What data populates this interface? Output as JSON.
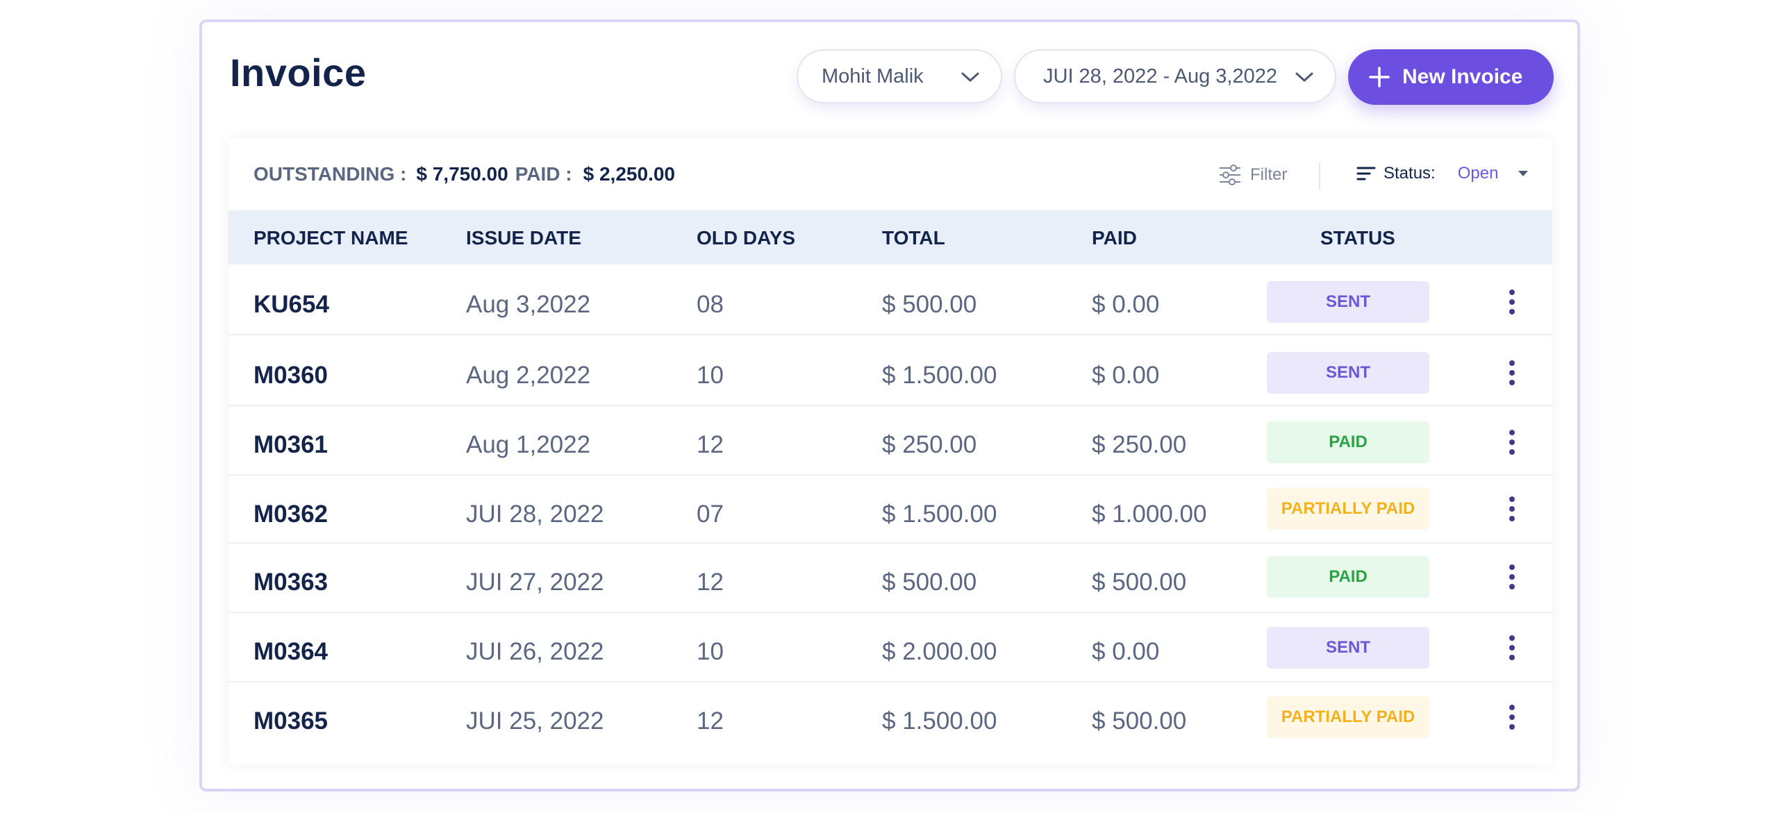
{
  "header": {
    "title": "Invoice",
    "user_select": "Mohit Malik",
    "date_range": "JUI 28, 2022 - Aug 3,2022",
    "new_invoice_label": "New Invoice"
  },
  "summary": {
    "outstanding_label": "OUTSTANDING :",
    "outstanding_value": "$ 7,750.00",
    "paid_label": "PAID :",
    "paid_value": "$ 2,250.00"
  },
  "filters": {
    "filter_label": "Filter",
    "status_label": "Status:",
    "status_value": "Open"
  },
  "table": {
    "columns": [
      "PROJECT NAME",
      "ISSUE DATE",
      "OLD DAYS",
      "TOTAL",
      "PAID",
      "STATUS"
    ],
    "rows": [
      {
        "project": "KU654",
        "issue_date": "Aug 3,2022",
        "old_days": "08",
        "total": "$ 500.00",
        "paid": "$ 0.00",
        "status": "SENT"
      },
      {
        "project": "M0360",
        "issue_date": "Aug 2,2022",
        "old_days": "10",
        "total": "$ 1.500.00",
        "paid": "$ 0.00",
        "status": "SENT"
      },
      {
        "project": "M0361",
        "issue_date": "Aug 1,2022",
        "old_days": "12",
        "total": "$ 250.00",
        "paid": "$ 250.00",
        "status": "PAID"
      },
      {
        "project": "M0362",
        "issue_date": "JUI 28, 2022",
        "old_days": "07",
        "total": "$ 1.500.00",
        "paid": "$ 1.000.00",
        "status": "PARTIALLY PAID"
      },
      {
        "project": "M0363",
        "issue_date": "JUI 27, 2022",
        "old_days": "12",
        "total": "$ 500.00",
        "paid": "$ 500.00",
        "status": "PAID"
      },
      {
        "project": "M0364",
        "issue_date": "JUI 26, 2022",
        "old_days": "10",
        "total": "$ 2.000.00",
        "paid": "$ 0.00",
        "status": "SENT"
      },
      {
        "project": "M0365",
        "issue_date": "JUI 25, 2022",
        "old_days": "12",
        "total": "$ 1.500.00",
        "paid": "$ 500.00",
        "status": "PARTIALLY PAID"
      }
    ]
  },
  "colors": {
    "accent": "#6c4fe0",
    "sent": "#6a57d6",
    "paid": "#2aa344",
    "partially_paid": "#f2b21c",
    "header_bg": "#e8eff9"
  },
  "icons": {
    "user_chevron": "chevron-down-icon",
    "date_chevron": "chevron-down-icon",
    "new_invoice": "plus-icon",
    "filter": "sliders-icon",
    "status_sort": "sort-lines-icon",
    "status_caret": "caret-down-icon",
    "row_menu": "kebab-menu-icon"
  }
}
